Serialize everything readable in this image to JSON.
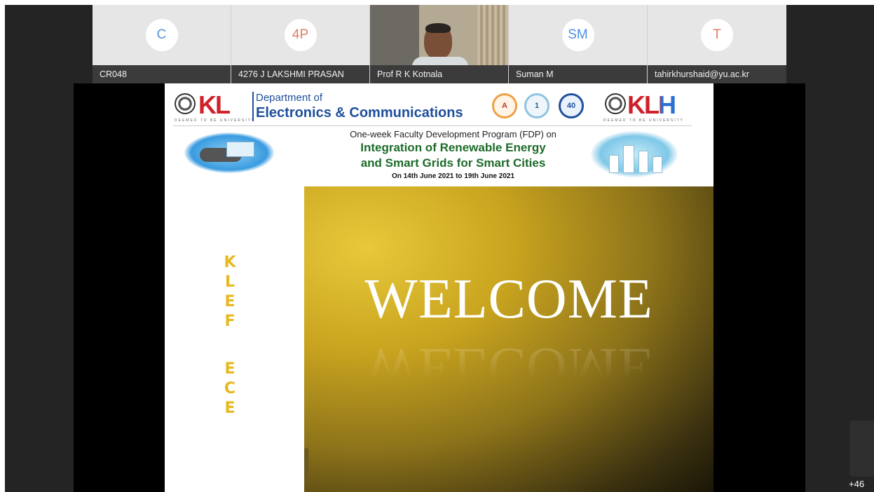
{
  "participants": [
    {
      "initials": "C",
      "name": "CR048",
      "color": "#5b8fd6"
    },
    {
      "initials": "4P",
      "name": "4276 J LAKSHMI PRASAN",
      "color": "#e47c63"
    },
    {
      "initials": "",
      "name": "Prof R K Kotnala",
      "video": true
    },
    {
      "initials": "SM",
      "name": "Suman M",
      "color": "#4f8fe0"
    },
    {
      "initials": "T",
      "name": "tahirkhurshaid@yu.ac.kr",
      "color": "#e47c63"
    }
  ],
  "slide": {
    "logo_left": "KL",
    "logo_left_tag": "DEEMED TO BE UNIVERSITY",
    "logo_right": "KLH",
    "logo_right_tag": "DEEMED TO BE UNIVERSITY",
    "dept_line1": "Department of",
    "dept_line2": "Electronics & Communications",
    "badges": [
      "A",
      "1",
      "40"
    ],
    "fdp_sub": "One-week Faculty Development Program (FDP) on",
    "fdp_title1": "Integration of Renewable Energy",
    "fdp_title2": "and Smart Grids for Smart Cities",
    "fdp_date": "On 14th June 2021 to 19th June 2021",
    "side_letters": [
      "K",
      "L",
      "E",
      "F",
      "",
      "E",
      "C",
      "E"
    ],
    "welcome": "WELCOME"
  },
  "more_count": "+46"
}
